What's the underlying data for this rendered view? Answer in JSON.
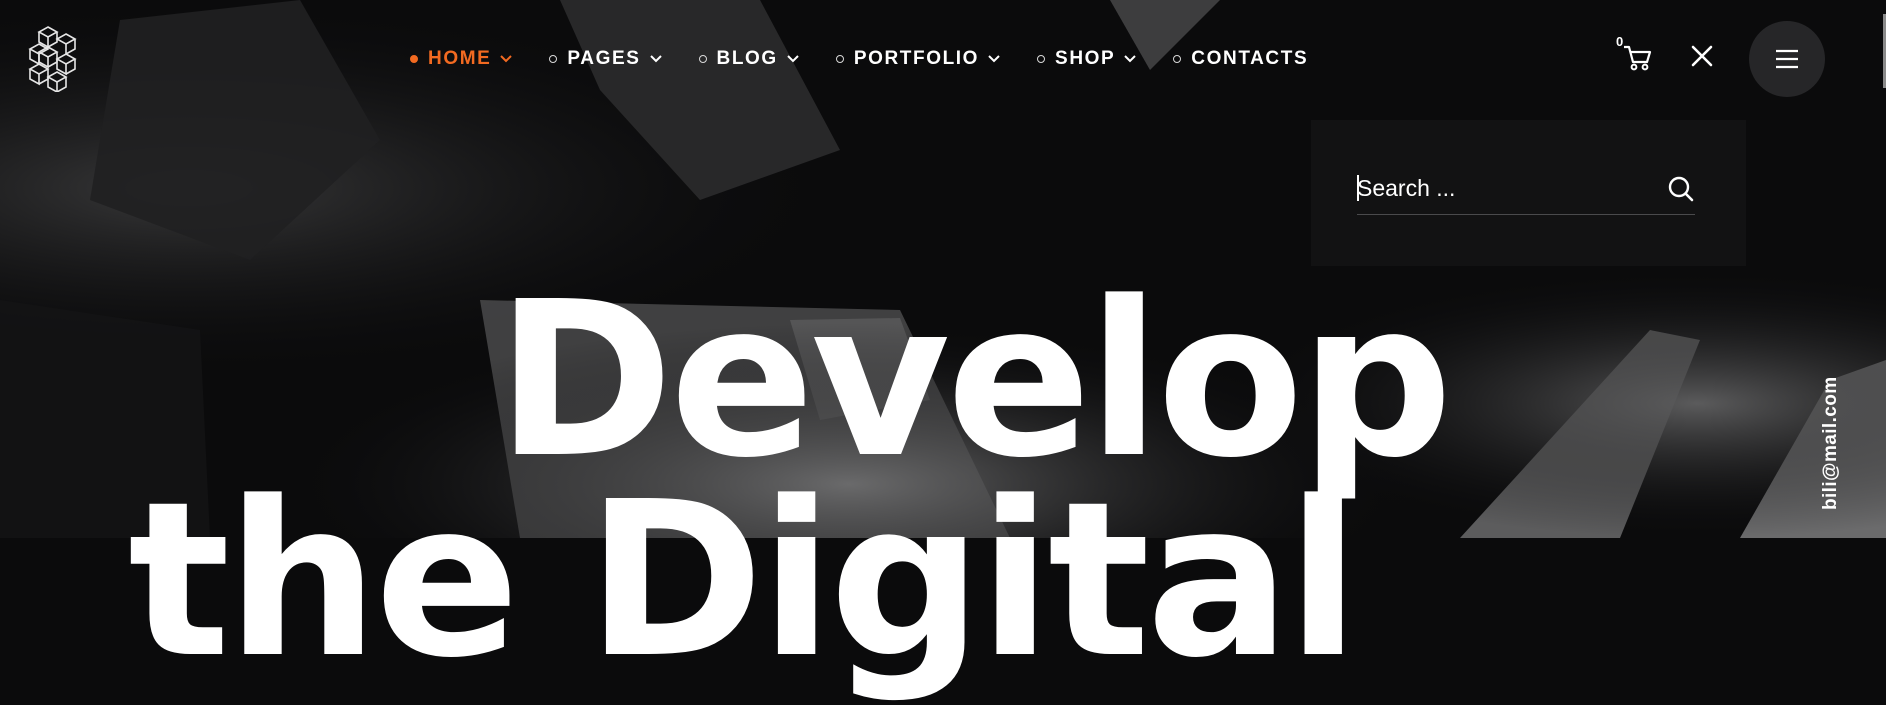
{
  "nav": {
    "items": [
      {
        "label": "HOME",
        "active": true,
        "has_dropdown": true
      },
      {
        "label": "PAGES",
        "active": false,
        "has_dropdown": true
      },
      {
        "label": "BLOG",
        "active": false,
        "has_dropdown": true
      },
      {
        "label": "PORTFOLIO",
        "active": false,
        "has_dropdown": true
      },
      {
        "label": "SHOP",
        "active": false,
        "has_dropdown": true
      },
      {
        "label": "CONTACTS",
        "active": false,
        "has_dropdown": false
      }
    ]
  },
  "cart": {
    "count": "0",
    "icon": "cart-icon"
  },
  "search": {
    "placeholder": "Search ...",
    "value": ""
  },
  "hero": {
    "line1": "Develop",
    "line2": "the Digital"
  },
  "contact": {
    "email": "bili@mail.com"
  },
  "colors": {
    "accent": "#f26a21",
    "background": "#0b0b0c",
    "panel": "#121213",
    "menu_button": "#262628"
  },
  "icons": [
    "logo-cubes-icon",
    "chevron-down-icon",
    "cart-icon",
    "close-icon",
    "hamburger-icon",
    "search-icon"
  ]
}
